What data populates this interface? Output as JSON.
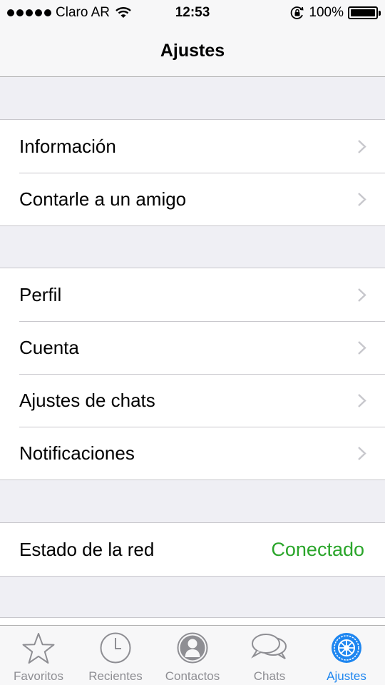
{
  "status_bar": {
    "carrier": "Claro AR",
    "time": "12:53",
    "battery": "100%"
  },
  "nav": {
    "title": "Ajustes"
  },
  "groups": [
    {
      "items": [
        {
          "label": "Información"
        },
        {
          "label": "Contarle a un amigo"
        }
      ]
    },
    {
      "items": [
        {
          "label": "Perfil"
        },
        {
          "label": "Cuenta"
        },
        {
          "label": "Ajustes de chats"
        },
        {
          "label": "Notificaciones"
        }
      ]
    },
    {
      "items": [
        {
          "label": "Estado de la red",
          "value": "Conectado"
        }
      ]
    }
  ],
  "colors": {
    "accent": "#1e86f0",
    "status_ok": "#2aa52a"
  },
  "tabs": [
    {
      "label": "Favoritos",
      "icon": "star-icon"
    },
    {
      "label": "Recientes",
      "icon": "clock-icon"
    },
    {
      "label": "Contactos",
      "icon": "contact-icon"
    },
    {
      "label": "Chats",
      "icon": "chat-bubbles-icon"
    },
    {
      "label": "Ajustes",
      "icon": "gear-icon",
      "active": true
    }
  ]
}
